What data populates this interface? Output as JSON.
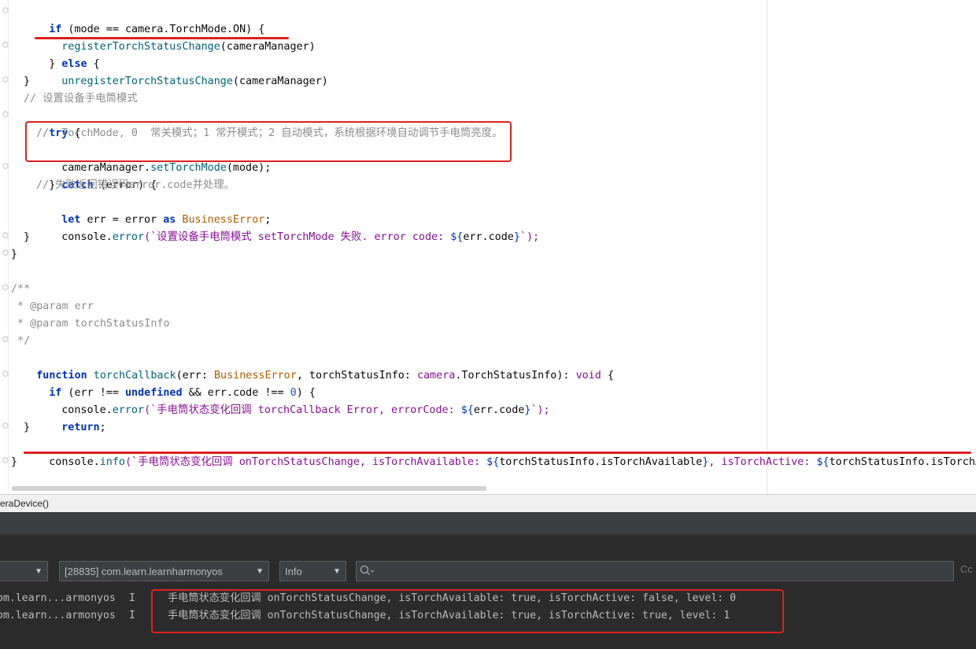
{
  "editor": {
    "lines": {
      "l1": [
        "if (mode == camera.TorchMode.ON) {"
      ],
      "l2": [
        "registerTorchStatusChange",
        "(cameraManager)"
      ],
      "l3": [
        "} else {"
      ],
      "l4": [
        "unregisterTorchStatusChange",
        "(cameraManager)"
      ],
      "l5": [
        "}"
      ],
      "l6": [
        "// 设置设备手电筒模式"
      ],
      "l7": [
        "try {"
      ],
      "l8": [
        "//  TorchMode, 0  常关模式；1 常开模式；2 自动模式，系统根据环境自动调节手电筒亮度。"
      ],
      "l9": [
        "cameraManager.",
        "setTorchMode",
        "(mode);"
      ],
      "l10": [
        "} catch (error) {"
      ],
      "l11": [
        "// 失败返回错误码error.code并处理。"
      ],
      "l12": [
        "let",
        " err = error ",
        "as",
        " BusinessError",
        ";"
      ],
      "l13": [
        "console.",
        "error",
        "(`设置设备手电筒模式 setTorchMode 失败. error code: ",
        "${",
        "err.code",
        "}",
        "`);"
      ],
      "l14": [
        "}"
      ],
      "l15": [
        "}"
      ],
      "l16": [
        "/**"
      ],
      "l17": [
        " * @param err"
      ],
      "l18": [
        " * @param torchStatusInfo"
      ],
      "l19": [
        " */"
      ],
      "l20": [
        "function",
        " torchCallback",
        "(err: ",
        "BusinessError",
        ", torchStatusInfo: ",
        "camera",
        ".TorchStatusInfo): ",
        "void",
        " {"
      ],
      "l21": [
        "if",
        " (err !== ",
        "undefined",
        " && err.code !== ",
        "0",
        ") {"
      ],
      "l22": [
        "console.",
        "error",
        "(`手电筒状态变化回调 torchCallback Error, errorCode: ",
        "${",
        "err.code",
        "}",
        "`);"
      ],
      "l23": [
        "return",
        ";"
      ],
      "l24": [
        "}"
      ],
      "l25": [
        "console.",
        "info",
        "(`手电筒状态变化回调 onTorchStatusChange, isTorchAvailable: ",
        "${",
        "torchStatusInfo.isTorchAvailable",
        "}",
        ", isTorchActive: ",
        "${",
        "torchStatusInfo.isTorchActive"
      ],
      "l26": [
        "}"
      ]
    }
  },
  "breadcrumb": {
    "text": "eraDevice()"
  },
  "filters": {
    "device_label": "",
    "process_label": "[28835] com.learn.learnharmonyos",
    "level_label": "Info",
    "search_placeholder": "",
    "cc_label": "Cc"
  },
  "log": {
    "rows": [
      {
        "tag": "om.learn...armonyos",
        "level": "I",
        "message": "手电筒状态变化回调 onTorchStatusChange, isTorchAvailable: true, isTorchActive: false, level: 0"
      },
      {
        "tag": "om.learn...armonyos",
        "level": "I",
        "message": "手电筒状态变化回调 onTorchStatusChange, isTorchAvailable: true, isTorchActive: true, level: 1"
      }
    ]
  },
  "colors": {
    "highlight_red": "#e02020",
    "keyword": "#0033b3",
    "function": "#00627a",
    "comment": "#8c8c8c"
  }
}
